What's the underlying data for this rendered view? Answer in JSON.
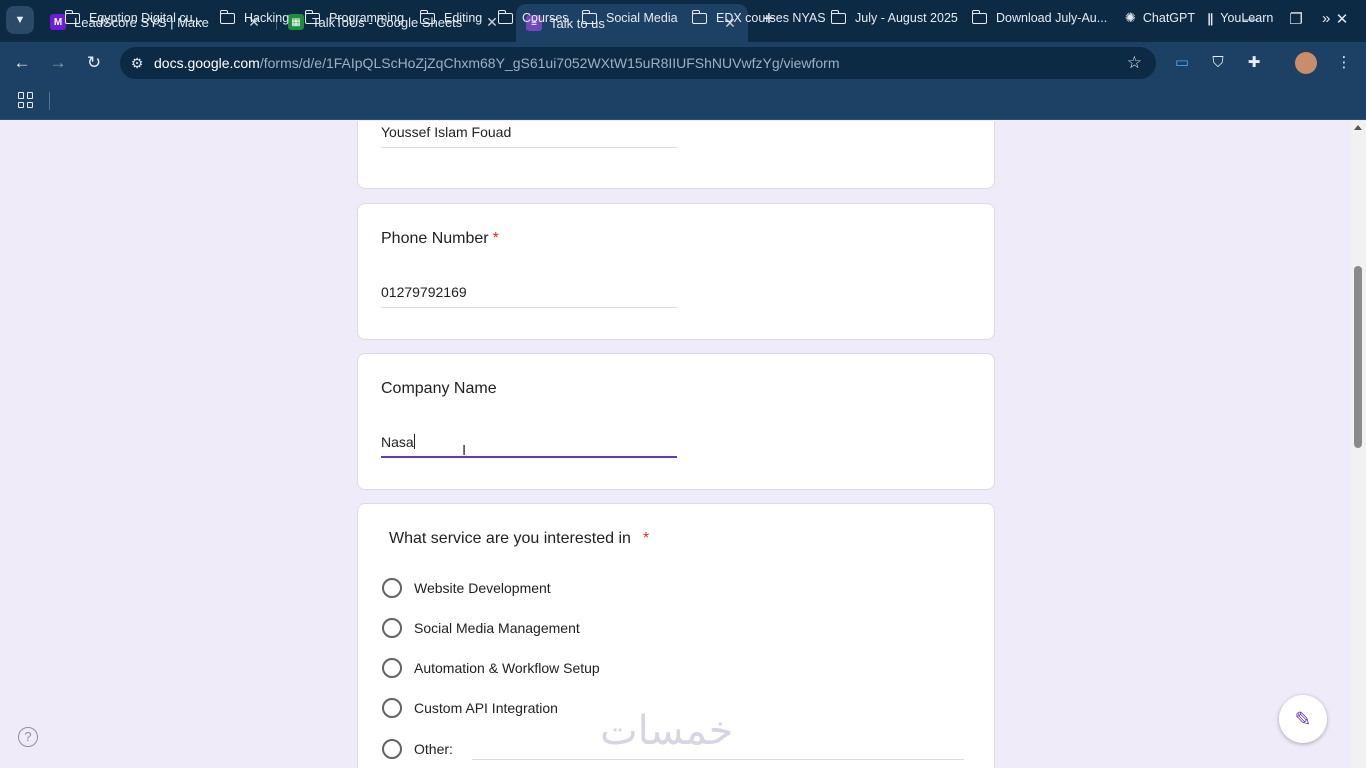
{
  "browser": {
    "tabs": [
      {
        "title": "LeadScore SYS | Make",
        "favicon": "make-icon",
        "favicon_color": "#6d1ed4"
      },
      {
        "title": "TalkToUs - Google Sheets",
        "favicon": "sheets-icon",
        "favicon_color": "#1e8e3e"
      },
      {
        "title": "Talk to us",
        "favicon": "forms-icon",
        "favicon_color": "#7248b9"
      }
    ],
    "active_tab": 2,
    "url_domain": "docs.google.com",
    "url_path": "/forms/d/e/1FAIpQLScHoZjZqChxm68Y_gS61ui7052WXtW15uR8IIUFShNUVwfzYg/viewform",
    "bookmarks": [
      {
        "label": "Egyption Digital cu...",
        "icon": "folder-icon"
      },
      {
        "label": "Hacking",
        "icon": "folder-icon"
      },
      {
        "label": "Programming",
        "icon": "folder-icon"
      },
      {
        "label": "Editing",
        "icon": "folder-icon"
      },
      {
        "label": "Courses",
        "icon": "folder-icon"
      },
      {
        "label": "Social Media",
        "icon": "folder-icon"
      },
      {
        "label": "EDX courses NYAS",
        "icon": "folder-icon"
      },
      {
        "label": "July - August 2025",
        "icon": "folder-icon"
      },
      {
        "label": "Download July-Au...",
        "icon": "folder-icon"
      },
      {
        "label": "ChatGPT",
        "icon": "chatgpt-icon"
      },
      {
        "label": "YouLearn",
        "icon": "youlearn-icon"
      }
    ]
  },
  "form": {
    "name_answer": "Youssef Islam Fouad",
    "phone": {
      "label": "Phone Number",
      "required_mark": "*",
      "value": "01279792169"
    },
    "company": {
      "label": "Company Name",
      "value": "Nasa"
    },
    "service": {
      "label": "What service are you interested in",
      "required_mark": "*",
      "options": [
        "Website Development",
        "Social Media Management",
        "Automation & Workflow Setup",
        "Custom API Integration",
        "Other:"
      ]
    }
  },
  "watermark": "خمسات",
  "colors": {
    "accent": "#673ab7",
    "required": "#d93025",
    "page_bg": "#f0ebf8",
    "chrome_dark": "#0c2a44",
    "chrome": "#1d4164"
  }
}
